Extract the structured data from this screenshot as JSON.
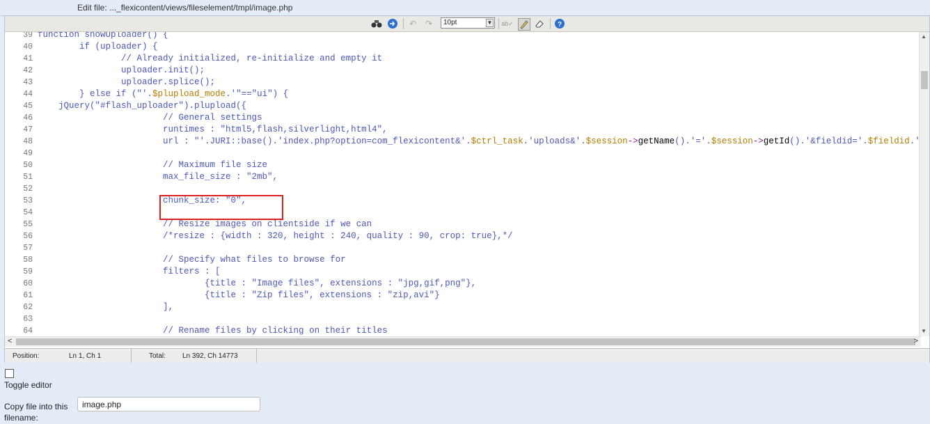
{
  "title_prefix": "Edit file: ..._flexicontent/views/fileselement/tmpl/image.php",
  "toolbar": {
    "font_size": "10pt",
    "buttons": [
      "search-icon",
      "goto-icon",
      "undo-icon",
      "redo-icon",
      "spellcheck-icon",
      "highlight-icon",
      "reset-icon",
      "help-icon"
    ]
  },
  "code_lines": [
    {
      "n": "39",
      "t": "function showUploader() {"
    },
    {
      "n": "40",
      "t": "        if (uploader) {"
    },
    {
      "n": "41",
      "t": "                // Already initialized, re-initialize and empty it"
    },
    {
      "n": "42",
      "t": "                uploader.init();"
    },
    {
      "n": "43",
      "t": "                uploader.splice();"
    },
    {
      "n": "44",
      "t": "        } else if (\"'.$plupload_mode.'\"==\"ui\") {"
    },
    {
      "n": "45",
      "t": "    jQuery(\"#flash_uploader\").plupload({"
    },
    {
      "n": "46",
      "t": "                        // General settings"
    },
    {
      "n": "47",
      "t": "                        runtimes : \"html5,flash,silverlight,html4\","
    },
    {
      "n": "48",
      "t": "                        url : \"'.JURI::base().'index.php?option=com_flexicontent&'.$ctrl_task.'uploads&'.$session->getName().'='.$session->getId().'&fieldid='.$fieldid.'"
    },
    {
      "n": "49",
      "t": ""
    },
    {
      "n": "50",
      "t": "                        // Maximum file size"
    },
    {
      "n": "51",
      "t": "                        max_file_size : \"2mb\","
    },
    {
      "n": "52",
      "t": ""
    },
    {
      "n": "53",
      "t": "                        chunk_size: \"0\","
    },
    {
      "n": "54",
      "t": ""
    },
    {
      "n": "55",
      "t": "                        // Resize images on clientside if we can"
    },
    {
      "n": "56",
      "t": "                        /*resize : {width : 320, height : 240, quality : 90, crop: true},*/"
    },
    {
      "n": "57",
      "t": ""
    },
    {
      "n": "58",
      "t": "                        // Specify what files to browse for"
    },
    {
      "n": "59",
      "t": "                        filters : ["
    },
    {
      "n": "60",
      "t": "                                {title : \"Image files\", extensions : \"jpg,gif,png\"},"
    },
    {
      "n": "61",
      "t": "                                {title : \"Zip files\", extensions : \"zip,avi\"}"
    },
    {
      "n": "62",
      "t": "                        ],"
    },
    {
      "n": "63",
      "t": ""
    },
    {
      "n": "64",
      "t": "                        // Rename files by clicking on their titles"
    }
  ],
  "status": {
    "position_label": "Position:",
    "position_value": "Ln 1, Ch 1",
    "total_label": "Total:",
    "total_value": "Ln 392, Ch 14773"
  },
  "toggle_editor_label": "Toggle editor",
  "copy_label": "Copy file into this filename:",
  "copy_value": "image.php"
}
